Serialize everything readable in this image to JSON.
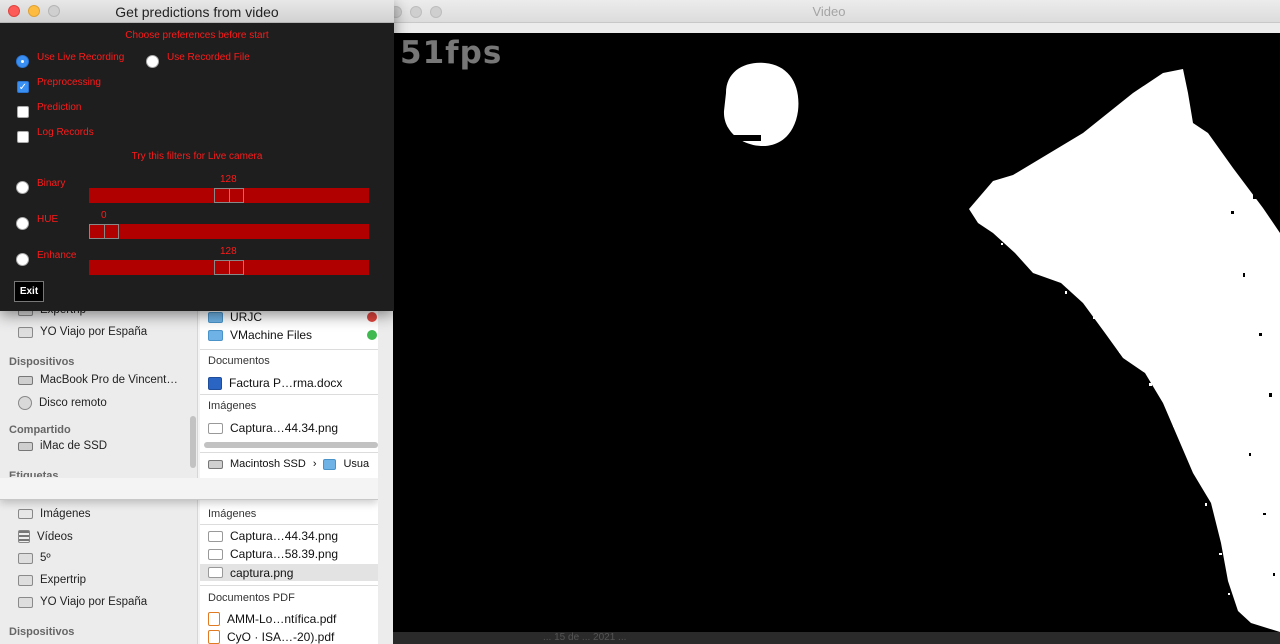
{
  "video_window": {
    "title": "Video",
    "fps_label": "51fps",
    "status_text": "... 15 de ... 2021 ..."
  },
  "control_panel": {
    "title": "Get predictions from video",
    "prefs_heading": "Choose preferences before start",
    "source_options": [
      {
        "label": "Use Live Recording",
        "selected": true
      },
      {
        "label": "Use Recorded File",
        "selected": false
      }
    ],
    "checkboxes": [
      {
        "label": "Preprocessing",
        "checked": true
      },
      {
        "label": "Prediction",
        "checked": false
      },
      {
        "label": "Log Records",
        "checked": false
      }
    ],
    "filters_heading": "Try this filters for Live camera",
    "filters": [
      {
        "label": "Binary",
        "value": "128",
        "value_num": 128,
        "max": 255
      },
      {
        "label": "HUE",
        "value": "0",
        "value_num": 0,
        "max": 255
      },
      {
        "label": "Enhance",
        "value": "128",
        "value_num": 128,
        "max": 255
      }
    ],
    "exit_label": "Exit",
    "colors": {
      "accent": "#ff1a1a",
      "slider": "#b00000",
      "background": "#1e1e1e"
    }
  },
  "finder_top": {
    "sidebar": {
      "items_top": [
        {
          "label": "Expertrip",
          "icon": "folder-icon"
        },
        {
          "label": "YO Viajo por España",
          "icon": "folder-icon"
        }
      ],
      "devices_heading": "Dispositivos",
      "devices": [
        {
          "label": "MacBook Pro de Vincent…",
          "icon": "laptop-icon"
        },
        {
          "label": "Disco remoto",
          "icon": "disc-icon"
        }
      ],
      "shared_heading": "Compartido",
      "shared": [
        {
          "label": "iMac de SSD",
          "icon": "monitor-icon"
        }
      ],
      "tags_heading": "Etiquetas"
    },
    "pane": {
      "folders": [
        {
          "label": "URJC",
          "tag_color": "#e0443e"
        },
        {
          "label": "VMachine Files",
          "tag_color": "#3fb950"
        }
      ],
      "documents_heading": "Documentos",
      "documents": [
        {
          "label": "Factura P…rma.docx",
          "icon": "word-doc-icon"
        }
      ],
      "images_heading": "Imágenes",
      "images": [
        {
          "label": "Captura…44.34.png",
          "icon": "image-icon"
        }
      ],
      "path": [
        "Macintosh SSD",
        "Usua"
      ]
    }
  },
  "finder_bottom": {
    "sidebar": {
      "items": [
        {
          "label": "Imágenes",
          "icon": "camera-icon"
        },
        {
          "label": "Vídeos",
          "icon": "film-icon"
        },
        {
          "label": "5º",
          "icon": "folder-icon"
        },
        {
          "label": "Expertrip",
          "icon": "folder-icon"
        },
        {
          "label": "YO Viajo por España",
          "icon": "folder-icon"
        }
      ],
      "devices_heading": "Dispositivos"
    },
    "pane": {
      "images_heading": "Imágenes",
      "images": [
        {
          "label": "Captura…44.34.png",
          "icon": "image-icon"
        },
        {
          "label": "Captura…58.39.png",
          "icon": "image-icon"
        },
        {
          "label": "captura.png",
          "icon": "image-icon",
          "selected": true
        }
      ],
      "pdf_heading": "Documentos PDF",
      "pdfs": [
        {
          "label": "AMM-Lo…ntífica.pdf",
          "icon": "pdf-icon"
        },
        {
          "label": "CyO · ISA…-20).pdf",
          "icon": "pdf-icon"
        }
      ]
    }
  }
}
